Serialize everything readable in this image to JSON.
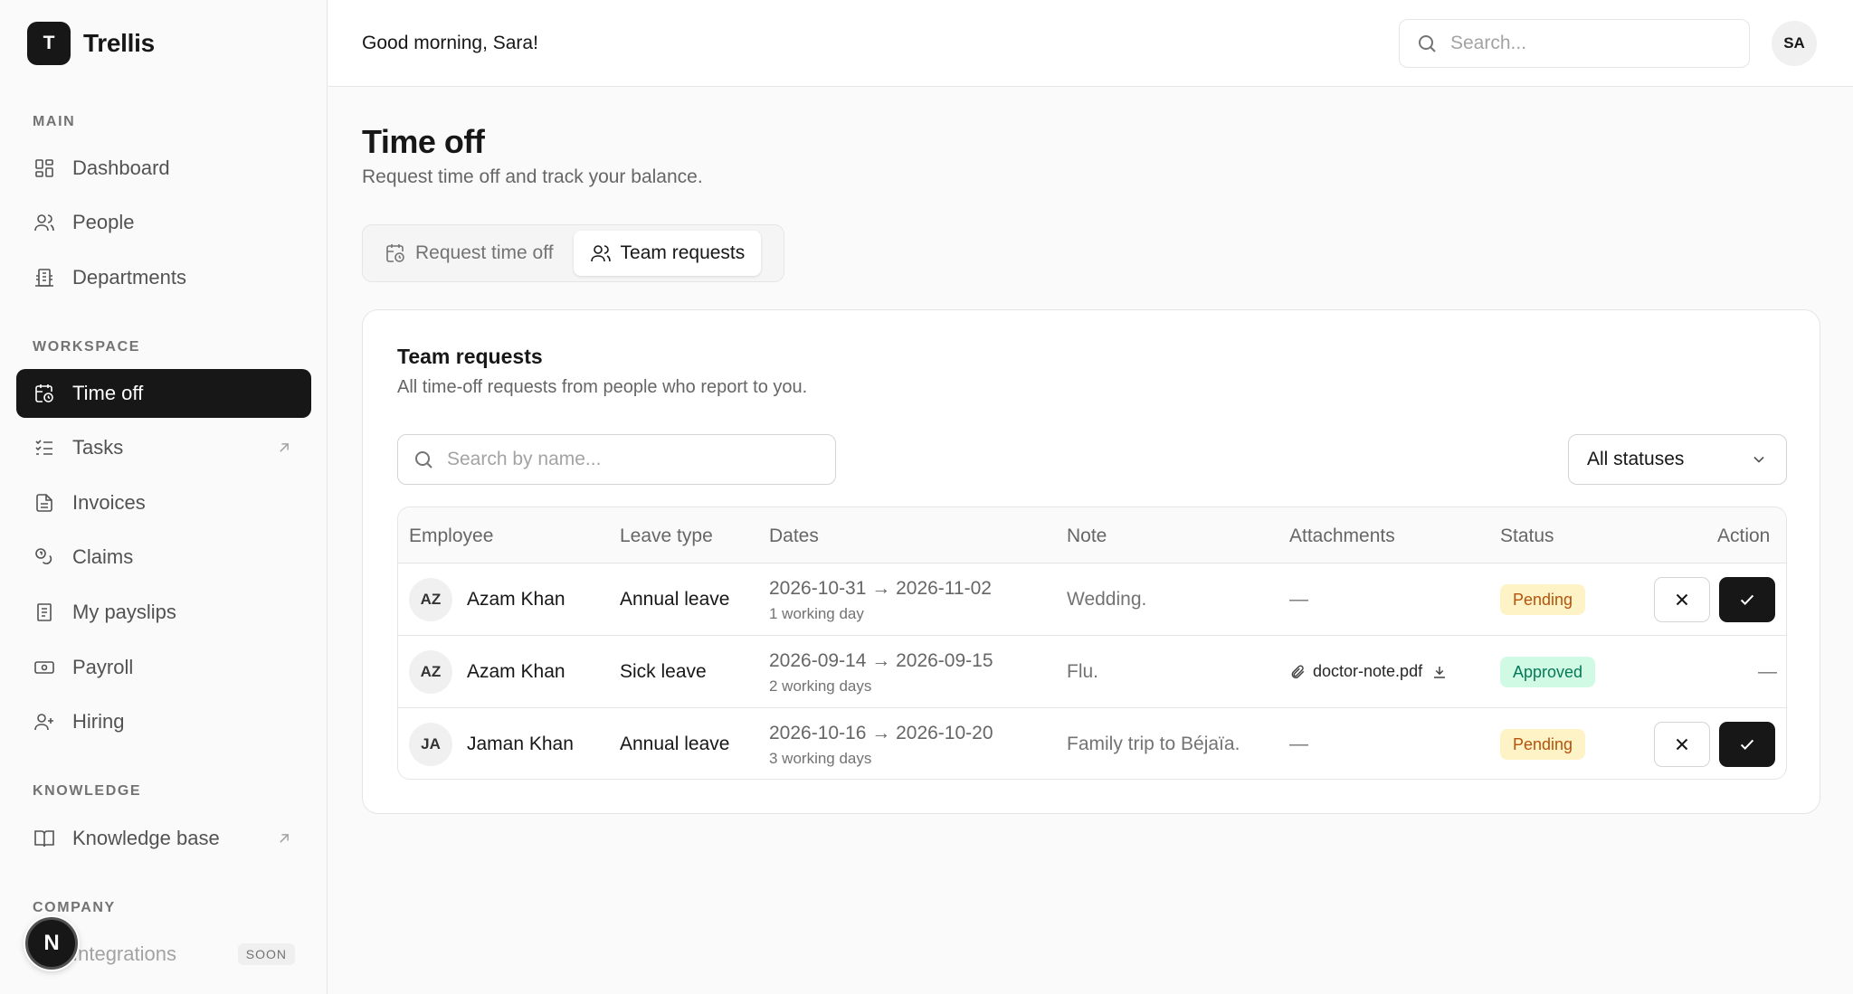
{
  "app": {
    "logo_letter": "T",
    "name": "Trellis"
  },
  "header": {
    "greeting": "Good morning, Sara!",
    "search_placeholder": "Search...",
    "avatar_initials": "SA"
  },
  "sidebar": {
    "sections": {
      "main": "MAIN",
      "workspace": "WORKSPACE",
      "knowledge": "KNOWLEDGE",
      "company": "COMPANY"
    },
    "items": [
      {
        "label": "Dashboard",
        "icon": "dashboard-icon"
      },
      {
        "label": "People",
        "icon": "people-icon"
      },
      {
        "label": "Departments",
        "icon": "building-icon"
      },
      {
        "label": "Time off",
        "icon": "calendar-clock-icon",
        "active": true
      },
      {
        "label": "Tasks",
        "icon": "checklist-icon",
        "external": true
      },
      {
        "label": "Invoices",
        "icon": "document-icon"
      },
      {
        "label": "Claims",
        "icon": "coins-icon"
      },
      {
        "label": "My payslips",
        "icon": "receipt-icon"
      },
      {
        "label": "Payroll",
        "icon": "banknote-icon"
      },
      {
        "label": "Hiring",
        "icon": "user-plus-icon"
      },
      {
        "label": "Knowledge base",
        "icon": "book-icon",
        "external": true
      },
      {
        "label": "Integrations",
        "icon": "plug-icon",
        "badge": "SOON"
      }
    ],
    "floating_badge": "N"
  },
  "page": {
    "title": "Time off",
    "subtitle": "Request time off and track your balance.",
    "tabs": [
      {
        "label": "Request time off",
        "icon": "calendar-clock-icon"
      },
      {
        "label": "Team requests",
        "icon": "people-icon",
        "active": true
      }
    ]
  },
  "card": {
    "title": "Team requests",
    "subtitle": "All time-off requests from people who report to you.",
    "search_placeholder": "Search by name...",
    "status_filter": "All statuses",
    "columns": [
      "Employee",
      "Leave type",
      "Dates",
      "Note",
      "Attachments",
      "Status",
      "Action"
    ],
    "rows": [
      {
        "initials": "AZ",
        "name": "Azam Khan",
        "leave_type": "Annual leave",
        "dates": "2026-10-31 → 2026-11-02",
        "days": "1 working day",
        "note": "Wedding.",
        "attachment": "—",
        "status": "Pending",
        "action": "buttons"
      },
      {
        "initials": "AZ",
        "name": "Azam Khan",
        "leave_type": "Sick leave",
        "dates": "2026-09-14 → 2026-09-15",
        "days": "2 working days",
        "note": "Flu.",
        "attachment": "doctor-note.pdf",
        "status": "Approved",
        "action": "—"
      },
      {
        "initials": "JA",
        "name": "Jaman Khan",
        "leave_type": "Annual leave",
        "dates": "2026-10-16 → 2026-10-20",
        "days": "3 working days",
        "note": "Family trip to Béjaïa.",
        "attachment": "—",
        "status": "Pending",
        "action": "buttons"
      }
    ]
  },
  "colors": {
    "primary": "#171717",
    "pending_bg": "#fef3c7",
    "pending_text": "#b45309",
    "approved_bg": "#d1fae5",
    "approved_text": "#047857"
  }
}
